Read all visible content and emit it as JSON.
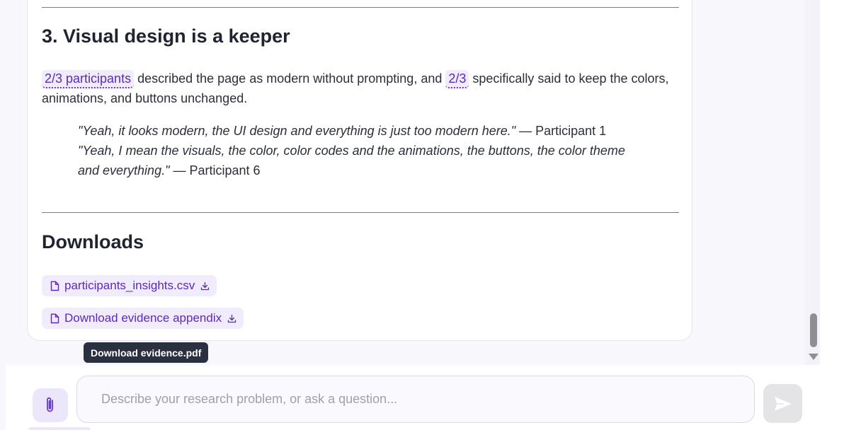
{
  "section": {
    "heading": "3. Visual design is a keeper",
    "para": {
      "chip1": "2/3 participants",
      "text1": " described the page as modern without prompting, and ",
      "chip2": "2/3",
      "text2": " specifically said to keep the colors, animations, and buttons unchanged."
    },
    "quotes": [
      {
        "text": "\"Yeah, it looks modern, the UI design and everything is just too modern here.\"",
        "attribution": " — Participant 1"
      },
      {
        "text": "\"Yeah, I mean the visuals, the color, color codes and the animations, the buttons, the color theme and everything.\"",
        "attribution": " — Participant 6"
      }
    ]
  },
  "downloads": {
    "heading": "Downloads",
    "items": [
      {
        "label": "participants_insights.csv",
        "icon": "file-icon"
      },
      {
        "label": "Download evidence appendix",
        "icon": "file-icon"
      }
    ],
    "tooltip": "Download evidence.pdf"
  },
  "composer": {
    "placeholder": "Describe your research problem, or ask a question...",
    "value": ""
  },
  "colors": {
    "accent": "#5b2bb5",
    "chip_bg": "#f1ecfc",
    "tooltip_bg": "#2b3040"
  }
}
